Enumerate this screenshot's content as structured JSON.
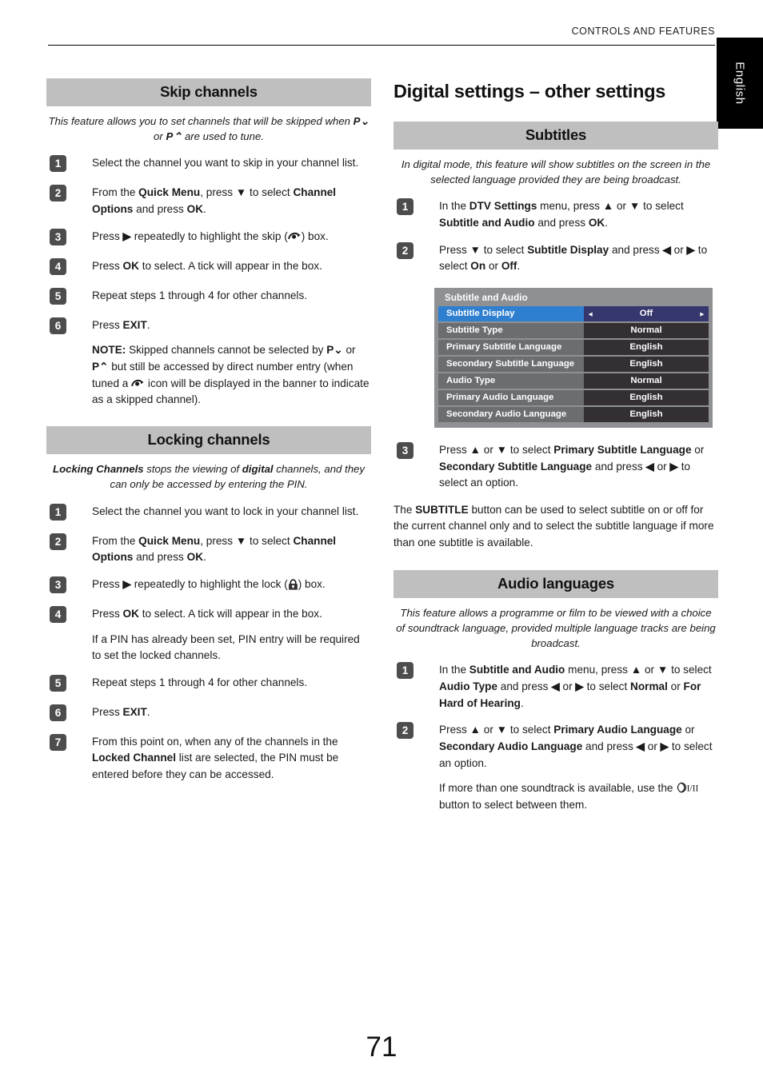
{
  "header": {
    "title": "CONTROLS AND FEATURES",
    "language_tab": "English"
  },
  "page_number": "71",
  "left_column": {
    "sections": [
      {
        "heading": "Skip channels",
        "intro_html": "This feature allows you to set channels that will be skipped when <b>P⌄</b> or <b>P⌃</b> are used to tune.",
        "steps": [
          {
            "num": "1",
            "html": "Select the channel you want to skip in your channel list."
          },
          {
            "num": "2",
            "html": "From the <b>Quick Menu</b>, press <b>▼</b> to select <b>Channel Options</b> and press <b>OK</b>."
          },
          {
            "num": "3",
            "html": "Press <b>▶</b> repeatedly to highlight the skip (<icon-skip>) box."
          },
          {
            "num": "4",
            "html": "Press <b>OK</b> to select. A tick will appear in the box."
          },
          {
            "num": "5",
            "html": "Repeat steps 1 through 4 for other channels."
          },
          {
            "num": "6",
            "html": "Press <b>EXIT</b>.",
            "note": "<b>NOTE:</b> Skipped channels cannot be selected by <b>P⌄</b> or <b>P⌃</b> but still be accessed by direct number entry (when tuned a <icon-skip> icon will be displayed in the banner to indicate as a skipped channel)."
          }
        ]
      },
      {
        "heading": "Locking channels",
        "intro_html": "<b>Locking Channels</b> stops the viewing of <b>digital</b> channels, and they can only be accessed by entering the PIN.",
        "steps": [
          {
            "num": "1",
            "html": "Select the channel you want to lock in your channel list."
          },
          {
            "num": "2",
            "html": "From the <b>Quick Menu</b>, press <b>▼</b> to select <b>Channel Options</b> and press <b>OK</b>."
          },
          {
            "num": "3",
            "html": "Press <b>▶</b> repeatedly to highlight the lock (<icon-lock>) box."
          },
          {
            "num": "4",
            "html": "Press <b>OK</b> to select. A tick will appear in the box.",
            "note": "If a PIN has already been set, PIN entry will be required to set the locked channels."
          },
          {
            "num": "5",
            "html": "Repeat steps 1 through 4 for other channels."
          },
          {
            "num": "6",
            "html": "Press <b>EXIT</b>."
          },
          {
            "num": "7",
            "html": "From this point on, when any of the channels in the <b>Locked Channel</b> list are selected, the PIN must be entered before they can be accessed."
          }
        ]
      }
    ]
  },
  "right_column": {
    "title": "Digital settings – other settings",
    "sections": [
      {
        "heading": "Subtitles",
        "intro_html": "In digital mode, this feature will show subtitles on the screen in the selected language provided they are being broadcast.",
        "steps": [
          {
            "num": "1",
            "html": "In the <b>DTV Settings</b> menu, press <b>▲</b> or <b>▼</b> to select <b>Subtitle and Audio</b> and press <b>OK</b>."
          },
          {
            "num": "2",
            "html": "Press <b>▼</b> to select <b>Subtitle Display</b> and press <b>◀</b> or <b>▶</b> to select <b>On</b> or <b>Off</b>."
          }
        ],
        "steps_after_menu": [
          {
            "num": "3",
            "html": "Press <b>▲</b> or <b>▼</b> to select <b>Primary Subtitle Language</b> or <b>Secondary Subtitle Language</b> and press <b>◀</b> or <b>▶</b> to select an option."
          }
        ],
        "trailing_para_html": "The <b>SUBTITLE</b> button can be used to select subtitle on or off for the current channel only and to select the subtitle language if more than one subtitle is available."
      },
      {
        "heading": "Audio languages",
        "intro_html": "This feature allows a programme or film to be viewed with a choice of soundtrack language, provided multiple language tracks are being broadcast.",
        "steps": [
          {
            "num": "1",
            "html": "In the <b>Subtitle and Audio</b> menu, press <b>▲</b> or <b>▼</b> to select <b>Audio Type</b> and press <b>◀</b> or <b>▶</b> to select <b>Normal</b> or <b>For Hard of Hearing</b>."
          },
          {
            "num": "2",
            "html": "Press <b>▲</b> or <b>▼</b> to select <b>Primary Audio Language</b> or <b>Secondary Audio Language</b> and press <b>◀</b> or <b>▶</b> to select an option.",
            "note": "If more than one soundtrack is available, use the <icon-stereo> button to select between them."
          }
        ]
      }
    ]
  },
  "osd_menu": {
    "title": "Subtitle and Audio",
    "rows": [
      {
        "label": "Subtitle Display",
        "value": "Off",
        "selected": true
      },
      {
        "label": "Subtitle Type",
        "value": "Normal",
        "selected": false
      },
      {
        "label": "Primary Subtitle Language",
        "value": "English",
        "selected": false
      },
      {
        "label": "Secondary Subtitle Language",
        "value": "English",
        "selected": false
      },
      {
        "label": "Audio Type",
        "value": "Normal",
        "selected": false
      },
      {
        "label": "Primary Audio Language",
        "value": "English",
        "selected": false
      },
      {
        "label": "Secondary Audio Language",
        "value": "English",
        "selected": false
      }
    ],
    "left_arrow": "◂",
    "right_arrow": "▸"
  },
  "colors": {
    "band": "#bfbfbf",
    "step_badge": "#4d4d4d",
    "osd_frame": "#8e9094",
    "osd_label": "#6b6d71",
    "osd_value": "#332f33",
    "osd_selected_label": "#2f7fd0",
    "osd_selected_value": "#35376d",
    "tab": "#000000"
  }
}
